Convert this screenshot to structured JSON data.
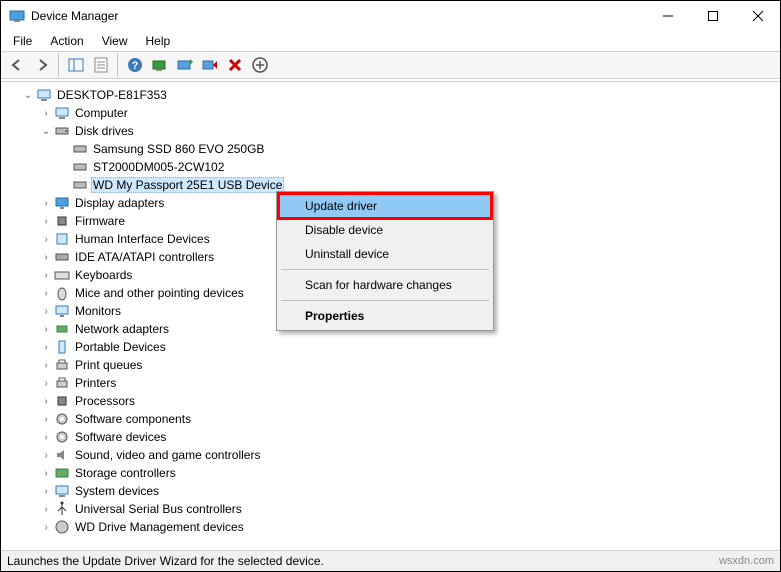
{
  "title": "Device Manager",
  "menu": {
    "file": "File",
    "action": "Action",
    "view": "View",
    "help": "Help"
  },
  "root": "DESKTOP-E81F353",
  "tree": {
    "computer": "Computer",
    "disk_drives": "Disk drives",
    "disks": [
      "Samsung SSD 860 EVO 250GB",
      "ST2000DM005-2CW102",
      "WD My Passport 25E1 USB Device"
    ],
    "display_adapters": "Display adapters",
    "firmware": "Firmware",
    "hid": "Human Interface Devices",
    "ide": "IDE ATA/ATAPI controllers",
    "keyboards": "Keyboards",
    "mice": "Mice and other pointing devices",
    "monitors": "Monitors",
    "network": "Network adapters",
    "portable": "Portable Devices",
    "print_queues": "Print queues",
    "printers": "Printers",
    "processors": "Processors",
    "soft_comp": "Software components",
    "soft_dev": "Software devices",
    "sound": "Sound, video and game controllers",
    "storage": "Storage controllers",
    "system": "System devices",
    "usb": "Universal Serial Bus controllers",
    "wd_mgmt": "WD Drive Management devices"
  },
  "context_menu": {
    "update": "Update driver",
    "disable": "Disable device",
    "uninstall": "Uninstall device",
    "scan": "Scan for hardware changes",
    "properties": "Properties"
  },
  "status": "Launches the Update Driver Wizard for the selected device.",
  "watermark": "wsxdn.com"
}
